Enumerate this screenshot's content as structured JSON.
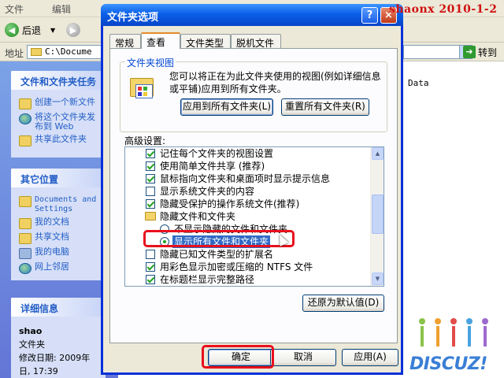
{
  "menubar": {
    "items": [
      "文件",
      "编辑"
    ]
  },
  "toolbar": {
    "back_label": "后退"
  },
  "address": {
    "label": "地址",
    "value": "C:\\Docume",
    "go_label": "转到"
  },
  "taskpane": {
    "tasks": {
      "title": "文件和文件夹任务",
      "items": [
        "创建一个新文件",
        "将这个文件夹发布到 Web",
        "共享此文件夹"
      ]
    },
    "places": {
      "title": "其它位置",
      "items": [
        "Documents and Settings",
        "我的文档",
        "共享文档",
        "我的电脑",
        "网上邻居"
      ]
    },
    "details": {
      "title": "详细信息",
      "name": "shao",
      "type": "文件夹",
      "modified_line1": "修改日期: 2009年",
      "modified_line2": "日, 17:39"
    }
  },
  "main": {
    "visible_text": "Data"
  },
  "watermark": "shaonx 2010-1-2",
  "dialog": {
    "title": "文件夹选项",
    "help_label": "?",
    "close_label": "×",
    "tabs": [
      {
        "label": "常规",
        "active": false
      },
      {
        "label": "查看",
        "active": true
      },
      {
        "label": "文件类型",
        "active": false
      },
      {
        "label": "脱机文件",
        "active": false
      }
    ],
    "folder_views": {
      "title": "文件夹视图",
      "description": "您可以将正在为此文件夹使用的视图(例如详细信息或平铺)应用到所有文件夹。",
      "apply_all": "应用到所有文件夹(L)",
      "reset_all": "重置所有文件夹(R)"
    },
    "advanced_label": "高级设置:",
    "settings": [
      {
        "kind": "checkbox",
        "checked": true,
        "label": "记住每个文件夹的视图设置"
      },
      {
        "kind": "checkbox",
        "checked": true,
        "label": "使用简单文件共享 (推荐)"
      },
      {
        "kind": "checkbox",
        "checked": true,
        "label": "鼠标指向文件夹和桌面项时显示提示信息"
      },
      {
        "kind": "checkbox",
        "checked": false,
        "label": "显示系统文件夹的内容"
      },
      {
        "kind": "checkbox",
        "checked": true,
        "label": "隐藏受保护的操作系统文件(推荐)"
      },
      {
        "kind": "folder",
        "label": "隐藏文件和文件夹"
      },
      {
        "kind": "radio",
        "checked": false,
        "label": "不显示隐藏的文件和文件夹"
      },
      {
        "kind": "radio",
        "checked": true,
        "label": "显示所有文件和文件夹",
        "selected": true
      },
      {
        "kind": "checkbox",
        "checked": false,
        "label": "隐藏已知文件类型的扩展名"
      },
      {
        "kind": "checkbox",
        "checked": true,
        "label": "用彩色显示加密或压缩的 NTFS 文件"
      },
      {
        "kind": "checkbox",
        "checked": true,
        "label": "在标题栏显示完整路径"
      }
    ],
    "restore_defaults": "还原为默认值(D)",
    "ok": "确定",
    "cancel": "取消",
    "apply": "应用(A)"
  },
  "logo": {
    "text": "DISCUZ!"
  },
  "colors": {
    "titlebar": "#0a5fe8",
    "highlight": "#316ac5",
    "annotation": "#e8101c",
    "taskpane": "#6f8ee0"
  }
}
